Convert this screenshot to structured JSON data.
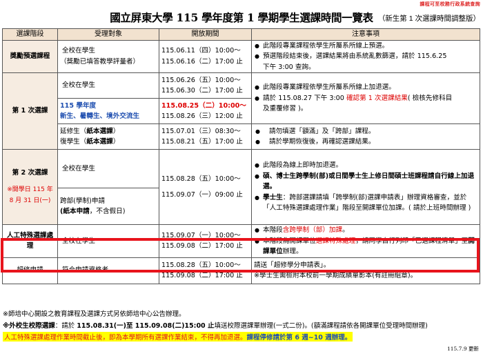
{
  "header": {
    "top_note": "課程可至校務行政系統查詢",
    "title": "國立屏東大學 115 學年度第 1 學期學生選課時間一覽表",
    "subtitle": "（新生第 1 次選課時間調整版）"
  },
  "table": {
    "headers": [
      "選課階段",
      "受理對象",
      "開放期間",
      "注意事項"
    ],
    "row1": {
      "phase": "獎勵預選課程",
      "target_1": "全校在學生",
      "target_2": "（獎勵已填答教學評量者）",
      "period_1": "115.06.11（四）10:00～",
      "period_2": "115.06.16（二）17:00 止",
      "note_1": "此階段專業課程依學生所屬系所線上預選。",
      "note_2": "預選階段結束後，選課結果將由系統亂數篩選，請於 115.6.25",
      "note_2b": "下午 3:00 查詢。"
    },
    "row2": {
      "phase": "第 1 次選課",
      "a_target": "全校在學生",
      "a_period_1": "115.06.26（五）10:00～",
      "a_period_2": "115.06.30（二）17:00 止",
      "b_target_1": "115 學年度",
      "b_target_2": "新生、暑轉生、境外交流生",
      "b_period_1": "115.08.25（二）10:00～",
      "b_period_2": "115.08.26（三）12:00 止",
      "note_1": "此階段專業課程依學生所屬系所線上加退選。",
      "note_2a": "請於 115.08.27 下午 3:00 ",
      "note_2b": "確認第 1 次選課結果",
      "note_2c": "( 檢核先修科目",
      "note_2d": "及重覆修習 )。",
      "c_target_1": "延修生（",
      "c_target_1b": "紙本選課",
      "c_target_1c": "）",
      "c_target_2": "復學生（",
      "c_target_2b": "紙本選課",
      "c_target_2c": "）",
      "c_period_1": "115.07.01（三）08:30～",
      "c_period_2": "115.08.21（五）17:00 止",
      "c_note_1": "請勿填選「額滿」及「跨部」課程。",
      "c_note_2": "請於學期恢復後，再確認選課結果。"
    },
    "row3": {
      "phase": "第 2 次選課",
      "phase_note_1": "※開學日 115 年",
      "phase_note_2": "8 月 31 日(一)",
      "a_target": "全校在學生",
      "b_target_1": "跨部(學制)申請",
      "b_target_2a": "(紙本申請",
      "b_target_2b": "，不含假日)",
      "period_1": "115.08.28（五）10:00～",
      "period_2": "115.09.07（一）09:00 止",
      "note_1": "此階段為線上即時加退選。",
      "note_2": "碩、博士生跨學制(部)或日間學士生上修日間碩士班課程請自行線上加退選。",
      "note_3a": "學士生",
      "note_3b": "：跨部選課請填「跨學制(部)選課申請表」辦理資格審查，並於「人工特殊選課處理作業」階段至開課單位加課。( 請於上班時間辦理 )"
    },
    "row4": {
      "phase": "人工特殊選課處理",
      "target": "全校在學生",
      "period_1": "115.09.07（一）10:00～",
      "period_2": "115.09.08（二）17:00 止",
      "note_1a": "本階段",
      "note_1b": "含跨學制（部）加課",
      "note_1c": "。",
      "note_2a": "本階段為開課單位",
      "note_2b": "選課特殊處理",
      "note_2c": "，請同學自行列印「已選課程清單」至",
      "note_2d": "開課單位",
      "note_2e": "辦理。"
    },
    "row5": {
      "phase": "超修申請",
      "target": "符合申請資格者",
      "period_1": "115.08.28（五）10:00～",
      "period_2": "115.09.08（二）17:00 止",
      "note_1": "請送「超修學分申請表」。",
      "note_2": "※學士生需檢附本校前一學期成績單影本(有註冊組章)。"
    }
  },
  "footer": {
    "line1": "※師培中心開設之教育課程及選課方式另依師培中心公告辦理。",
    "line2a": "※外校生校際選課",
    "line2b": "：請於 ",
    "line2c": "115.08.31(一)至 115.09.08(二)15:00 止",
    "line2d": "填送校際選課單辦理(一式二份)。(額滿課程請依各開課單位受理時間辦理)",
    "line3a": "人工特殊選課處理作業時間截止後，即為本學期所有選課作業結束，不得再加退選。",
    "line3b": "課程停修請於第 6 週~10 週辦理。",
    "update": "115.7.9 更新"
  },
  "colors": {
    "header_bg": "#f2e2cf",
    "highlight_border": "#e8141c",
    "accent_red": "#d00000",
    "accent_blue": "#1f4fb0",
    "footer_highlight": "#ffff00"
  }
}
